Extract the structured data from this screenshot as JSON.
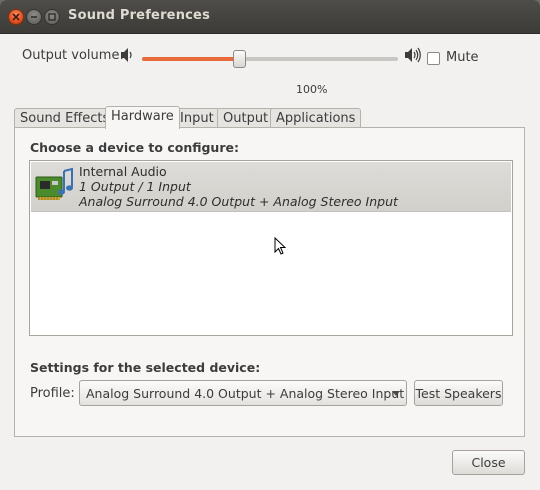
{
  "window": {
    "title": "Sound Preferences"
  },
  "volume": {
    "label": "Output volume:",
    "percent_label": "100%",
    "level": 0.38,
    "mute_label": "Mute",
    "muted": false
  },
  "tabs": [
    {
      "label": "Sound Effects",
      "active": false
    },
    {
      "label": "Hardware",
      "active": true
    },
    {
      "label": "Input",
      "active": false
    },
    {
      "label": "Output",
      "active": false
    },
    {
      "label": "Applications",
      "active": false
    }
  ],
  "hardware": {
    "choose_label": "Choose a device to configure:",
    "devices": [
      {
        "name": "Internal Audio",
        "line1": "1 Output / 1 Input",
        "line2": "Analog Surround 4.0 Output + Analog Stereo Input",
        "icon": "sound-card-icon"
      }
    ],
    "settings_label": "Settings for the selected device:",
    "profile_label": "Profile:",
    "profile_value": "Analog Surround 4.0 Output + Analog Stereo Input",
    "test_button": "Test Speakers"
  },
  "footer": {
    "close_button": "Close"
  },
  "colors": {
    "accent": "#e86a3a",
    "titlebar": "#3c3b37",
    "window_bg": "#f2f1f0"
  }
}
